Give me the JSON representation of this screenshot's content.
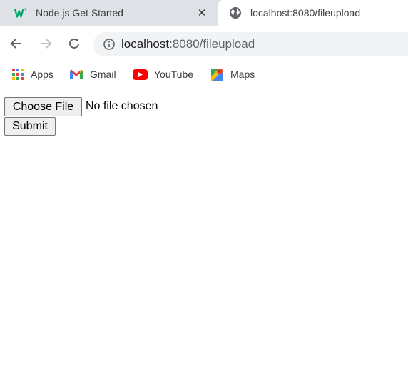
{
  "tabs": [
    {
      "title": "Node.js Get Started",
      "active": false,
      "favicon": "w3schools-icon"
    },
    {
      "title": "localhost:8080/fileupload",
      "active": true,
      "favicon": "globe-icon"
    }
  ],
  "toolbar": {
    "back_icon": "arrow-left-icon",
    "forward_icon": "arrow-right-icon",
    "reload_icon": "reload-icon",
    "url_host": "localhost",
    "url_path": ":8080/fileupload"
  },
  "bookmarks": [
    {
      "label": "Apps",
      "icon": "apps-grid-icon"
    },
    {
      "label": "Gmail",
      "icon": "gmail-icon"
    },
    {
      "label": "YouTube",
      "icon": "youtube-icon"
    },
    {
      "label": "Maps",
      "icon": "maps-icon"
    }
  ],
  "form": {
    "choose_file_label": "Choose File",
    "file_status": "No file chosen",
    "submit_label": "Submit"
  },
  "colors": {
    "tabstrip": "#dee1e6",
    "omnibox": "#f1f3f4",
    "w3_green": "#04aa6d",
    "youtube_red": "#ff0000"
  }
}
